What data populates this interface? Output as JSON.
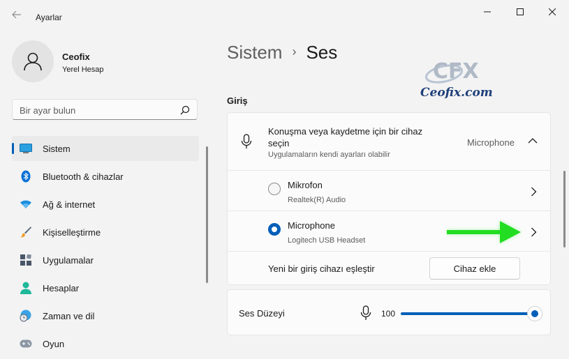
{
  "app": {
    "title": "Ayarlar"
  },
  "profile": {
    "name": "Ceofix",
    "account_type": "Yerel Hesap"
  },
  "search": {
    "placeholder": "Bir ayar bulun",
    "value": ""
  },
  "sidebar": {
    "items": [
      {
        "label": "Sistem",
        "icon": "monitor-icon",
        "active": true
      },
      {
        "label": "Bluetooth & cihazlar",
        "icon": "bluetooth-icon",
        "active": false
      },
      {
        "label": "Ağ & internet",
        "icon": "wifi-icon",
        "active": false
      },
      {
        "label": "Kişiselleştirme",
        "icon": "brush-icon",
        "active": false
      },
      {
        "label": "Uygulamalar",
        "icon": "apps-icon",
        "active": false
      },
      {
        "label": "Hesaplar",
        "icon": "person-icon",
        "active": false
      },
      {
        "label": "Zaman ve dil",
        "icon": "clock-globe-icon",
        "active": false
      },
      {
        "label": "Oyun",
        "icon": "gamepad-icon",
        "active": false
      }
    ]
  },
  "breadcrumb": {
    "parent": "Sistem",
    "separator": "›",
    "current": "Ses"
  },
  "watermark": {
    "logo_text": "CFX",
    "site": "Ceofix.com"
  },
  "input_section": {
    "title": "Giriş",
    "choose_device": {
      "title": "Konuşma veya kaydetme için bir cihaz seçin",
      "subtitle": "Uygulamaların kendi ayarları olabilir",
      "selected": "Microphone"
    },
    "devices": [
      {
        "name": "Mikrofon",
        "description": "Realtek(R) Audio",
        "selected": false
      },
      {
        "name": "Microphone",
        "description": "Logitech USB Headset",
        "selected": true
      }
    ],
    "pair": {
      "label": "Yeni bir giriş cihazı eşleştir",
      "button": "Cihaz ekle"
    }
  },
  "volume": {
    "label": "Ses Düzeyi",
    "value": "100",
    "level": 1.0
  },
  "colors": {
    "accent": "#005fb8",
    "arrow": "#22dd22",
    "background": "#f3f3f3",
    "card": "#fbfbfb"
  }
}
